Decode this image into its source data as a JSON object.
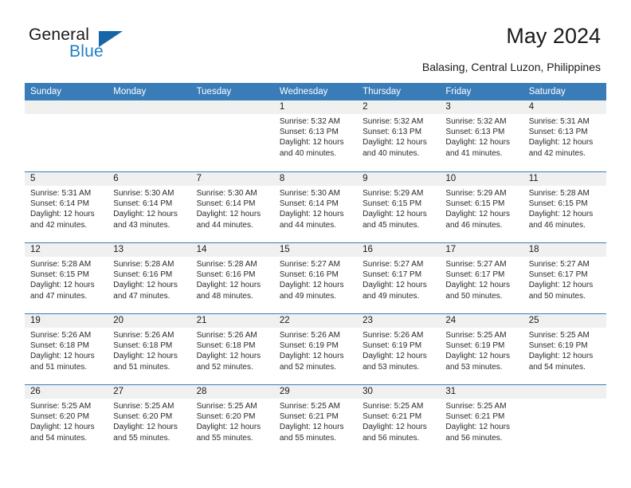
{
  "brand": {
    "name_part1": "General",
    "name_part2": "Blue",
    "accent_color": "#1f7ec4",
    "triangle_color": "#1565a8"
  },
  "header": {
    "title": "May 2024",
    "subtitle": "Balasing, Central Luzon, Philippines"
  },
  "calendar": {
    "header_color": "#3a7cb8",
    "weekday_headers": [
      "Sunday",
      "Monday",
      "Tuesday",
      "Wednesday",
      "Thursday",
      "Friday",
      "Saturday"
    ],
    "weeks": [
      [
        {
          "day": "",
          "empty": true
        },
        {
          "day": "",
          "empty": true
        },
        {
          "day": "",
          "empty": true
        },
        {
          "day": "1",
          "sunrise": "Sunrise: 5:32 AM",
          "sunset": "Sunset: 6:13 PM",
          "daylight": "Daylight: 12 hours and 40 minutes."
        },
        {
          "day": "2",
          "sunrise": "Sunrise: 5:32 AM",
          "sunset": "Sunset: 6:13 PM",
          "daylight": "Daylight: 12 hours and 40 minutes."
        },
        {
          "day": "3",
          "sunrise": "Sunrise: 5:32 AM",
          "sunset": "Sunset: 6:13 PM",
          "daylight": "Daylight: 12 hours and 41 minutes."
        },
        {
          "day": "4",
          "sunrise": "Sunrise: 5:31 AM",
          "sunset": "Sunset: 6:13 PM",
          "daylight": "Daylight: 12 hours and 42 minutes."
        }
      ],
      [
        {
          "day": "5",
          "sunrise": "Sunrise: 5:31 AM",
          "sunset": "Sunset: 6:14 PM",
          "daylight": "Daylight: 12 hours and 42 minutes."
        },
        {
          "day": "6",
          "sunrise": "Sunrise: 5:30 AM",
          "sunset": "Sunset: 6:14 PM",
          "daylight": "Daylight: 12 hours and 43 minutes."
        },
        {
          "day": "7",
          "sunrise": "Sunrise: 5:30 AM",
          "sunset": "Sunset: 6:14 PM",
          "daylight": "Daylight: 12 hours and 44 minutes."
        },
        {
          "day": "8",
          "sunrise": "Sunrise: 5:30 AM",
          "sunset": "Sunset: 6:14 PM",
          "daylight": "Daylight: 12 hours and 44 minutes."
        },
        {
          "day": "9",
          "sunrise": "Sunrise: 5:29 AM",
          "sunset": "Sunset: 6:15 PM",
          "daylight": "Daylight: 12 hours and 45 minutes."
        },
        {
          "day": "10",
          "sunrise": "Sunrise: 5:29 AM",
          "sunset": "Sunset: 6:15 PM",
          "daylight": "Daylight: 12 hours and 46 minutes."
        },
        {
          "day": "11",
          "sunrise": "Sunrise: 5:28 AM",
          "sunset": "Sunset: 6:15 PM",
          "daylight": "Daylight: 12 hours and 46 minutes."
        }
      ],
      [
        {
          "day": "12",
          "sunrise": "Sunrise: 5:28 AM",
          "sunset": "Sunset: 6:15 PM",
          "daylight": "Daylight: 12 hours and 47 minutes."
        },
        {
          "day": "13",
          "sunrise": "Sunrise: 5:28 AM",
          "sunset": "Sunset: 6:16 PM",
          "daylight": "Daylight: 12 hours and 47 minutes."
        },
        {
          "day": "14",
          "sunrise": "Sunrise: 5:28 AM",
          "sunset": "Sunset: 6:16 PM",
          "daylight": "Daylight: 12 hours and 48 minutes."
        },
        {
          "day": "15",
          "sunrise": "Sunrise: 5:27 AM",
          "sunset": "Sunset: 6:16 PM",
          "daylight": "Daylight: 12 hours and 49 minutes."
        },
        {
          "day": "16",
          "sunrise": "Sunrise: 5:27 AM",
          "sunset": "Sunset: 6:17 PM",
          "daylight": "Daylight: 12 hours and 49 minutes."
        },
        {
          "day": "17",
          "sunrise": "Sunrise: 5:27 AM",
          "sunset": "Sunset: 6:17 PM",
          "daylight": "Daylight: 12 hours and 50 minutes."
        },
        {
          "day": "18",
          "sunrise": "Sunrise: 5:27 AM",
          "sunset": "Sunset: 6:17 PM",
          "daylight": "Daylight: 12 hours and 50 minutes."
        }
      ],
      [
        {
          "day": "19",
          "sunrise": "Sunrise: 5:26 AM",
          "sunset": "Sunset: 6:18 PM",
          "daylight": "Daylight: 12 hours and 51 minutes."
        },
        {
          "day": "20",
          "sunrise": "Sunrise: 5:26 AM",
          "sunset": "Sunset: 6:18 PM",
          "daylight": "Daylight: 12 hours and 51 minutes."
        },
        {
          "day": "21",
          "sunrise": "Sunrise: 5:26 AM",
          "sunset": "Sunset: 6:18 PM",
          "daylight": "Daylight: 12 hours and 52 minutes."
        },
        {
          "day": "22",
          "sunrise": "Sunrise: 5:26 AM",
          "sunset": "Sunset: 6:19 PM",
          "daylight": "Daylight: 12 hours and 52 minutes."
        },
        {
          "day": "23",
          "sunrise": "Sunrise: 5:26 AM",
          "sunset": "Sunset: 6:19 PM",
          "daylight": "Daylight: 12 hours and 53 minutes."
        },
        {
          "day": "24",
          "sunrise": "Sunrise: 5:25 AM",
          "sunset": "Sunset: 6:19 PM",
          "daylight": "Daylight: 12 hours and 53 minutes."
        },
        {
          "day": "25",
          "sunrise": "Sunrise: 5:25 AM",
          "sunset": "Sunset: 6:19 PM",
          "daylight": "Daylight: 12 hours and 54 minutes."
        }
      ],
      [
        {
          "day": "26",
          "sunrise": "Sunrise: 5:25 AM",
          "sunset": "Sunset: 6:20 PM",
          "daylight": "Daylight: 12 hours and 54 minutes."
        },
        {
          "day": "27",
          "sunrise": "Sunrise: 5:25 AM",
          "sunset": "Sunset: 6:20 PM",
          "daylight": "Daylight: 12 hours and 55 minutes."
        },
        {
          "day": "28",
          "sunrise": "Sunrise: 5:25 AM",
          "sunset": "Sunset: 6:20 PM",
          "daylight": "Daylight: 12 hours and 55 minutes."
        },
        {
          "day": "29",
          "sunrise": "Sunrise: 5:25 AM",
          "sunset": "Sunset: 6:21 PM",
          "daylight": "Daylight: 12 hours and 55 minutes."
        },
        {
          "day": "30",
          "sunrise": "Sunrise: 5:25 AM",
          "sunset": "Sunset: 6:21 PM",
          "daylight": "Daylight: 12 hours and 56 minutes."
        },
        {
          "day": "31",
          "sunrise": "Sunrise: 5:25 AM",
          "sunset": "Sunset: 6:21 PM",
          "daylight": "Daylight: 12 hours and 56 minutes."
        },
        {
          "day": "",
          "empty": true
        }
      ]
    ]
  }
}
